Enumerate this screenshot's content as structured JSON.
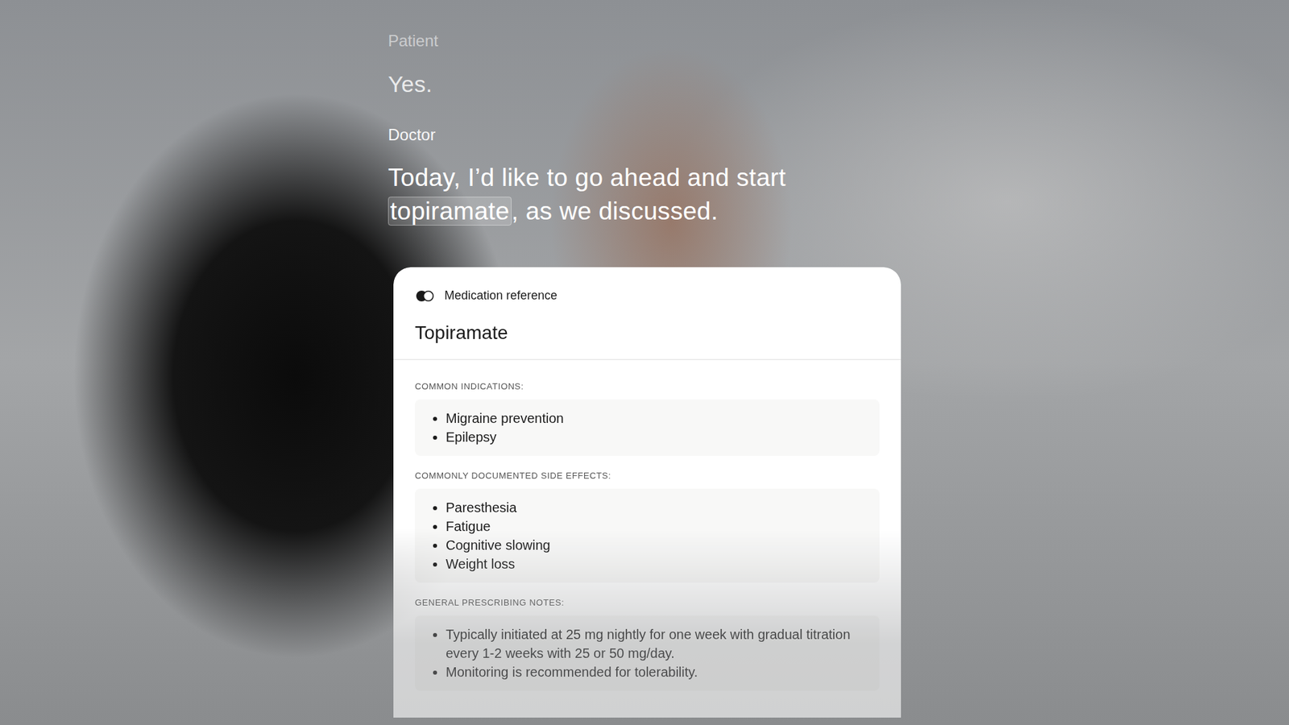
{
  "transcript": [
    {
      "speaker": "Patient",
      "dimmed": true,
      "segments": [
        {
          "text": "Yes.",
          "highlighted": false
        }
      ]
    },
    {
      "speaker": "Doctor",
      "dimmed": false,
      "segments": [
        {
          "text": "Today, I’d like to go ahead and start ",
          "highlighted": false
        },
        {
          "text": "topiramate",
          "highlighted": true
        },
        {
          "text": ", as we discussed.",
          "highlighted": false
        }
      ]
    }
  ],
  "card": {
    "badge": "Medication reference",
    "title": "Topiramate",
    "sections": [
      {
        "label": "COMMON INDICATIONS:",
        "items": [
          "Migraine prevention",
          "Epilepsy"
        ]
      },
      {
        "label": "COMMONLY DOCUMENTED SIDE EFFECTS:",
        "items": [
          "Paresthesia",
          "Fatigue",
          "Cognitive slowing",
          "Weight loss"
        ]
      },
      {
        "label": "GENERAL PRESCRIBING NOTES:",
        "items": [
          "Typically initiated at 25 mg nightly for one week with gradual titration every 1-2 weeks with 25 or 50 mg/day.",
          "Monitoring is recommended for tolerability."
        ]
      }
    ]
  }
}
